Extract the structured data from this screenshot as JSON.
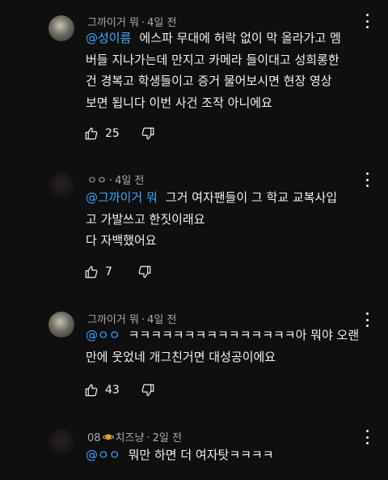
{
  "comments": [
    {
      "author": "그까이거 뭐",
      "time": "4일 전",
      "mention": "@성이름",
      "lines": [
        "에스파 무대에 허락 없이 막 올라가고 멤",
        "버들 지나가는데 만지고 카메라 들이대고 성희롱한",
        "건 경복고 학생들이고 증거 물어보시면 현장 영상",
        "보면 됩니다 이번 사건 조작 아니에요"
      ],
      "likes": "25"
    },
    {
      "author": "ㅇㅇ",
      "time": "4일 전",
      "mention": "@그까이거 뭐",
      "lines": [
        "그거 여자팬들이 그 학교 교복사입",
        "고 가발쓰고 한짓이래요",
        "다 자백했어요"
      ],
      "likes": "7"
    },
    {
      "author": "그까이거 뭐",
      "time": "4일 전",
      "mention": "@ㅇㅇ",
      "lines": [
        "ㅋㅋㅋㅋㅋㅋㅋㅋㅋㅋㅋㅋㅋㅋㅋ아 뭐야 오랜",
        "만에 웃었네 개그친거면 대성공이에요"
      ],
      "likes": "43"
    },
    {
      "author_prefix": "08",
      "author": "치즈냥",
      "time": "2일 전",
      "mention": "@ㅇㅇ",
      "lines": [
        "뭐만 하면 더 여자탓ㅋㅋㅋㅋ"
      ]
    }
  ],
  "separator": "·",
  "icons": {
    "like": "thumbs-up-icon",
    "dislike": "thumbs-down-icon",
    "more": "more-vertical-icon",
    "badge": "saturn-emoji-icon"
  },
  "colors": {
    "background": "#0f0f0f",
    "text": "#f1f1f1",
    "meta": "#aaaaaa",
    "mention": "#3ea6ff"
  }
}
